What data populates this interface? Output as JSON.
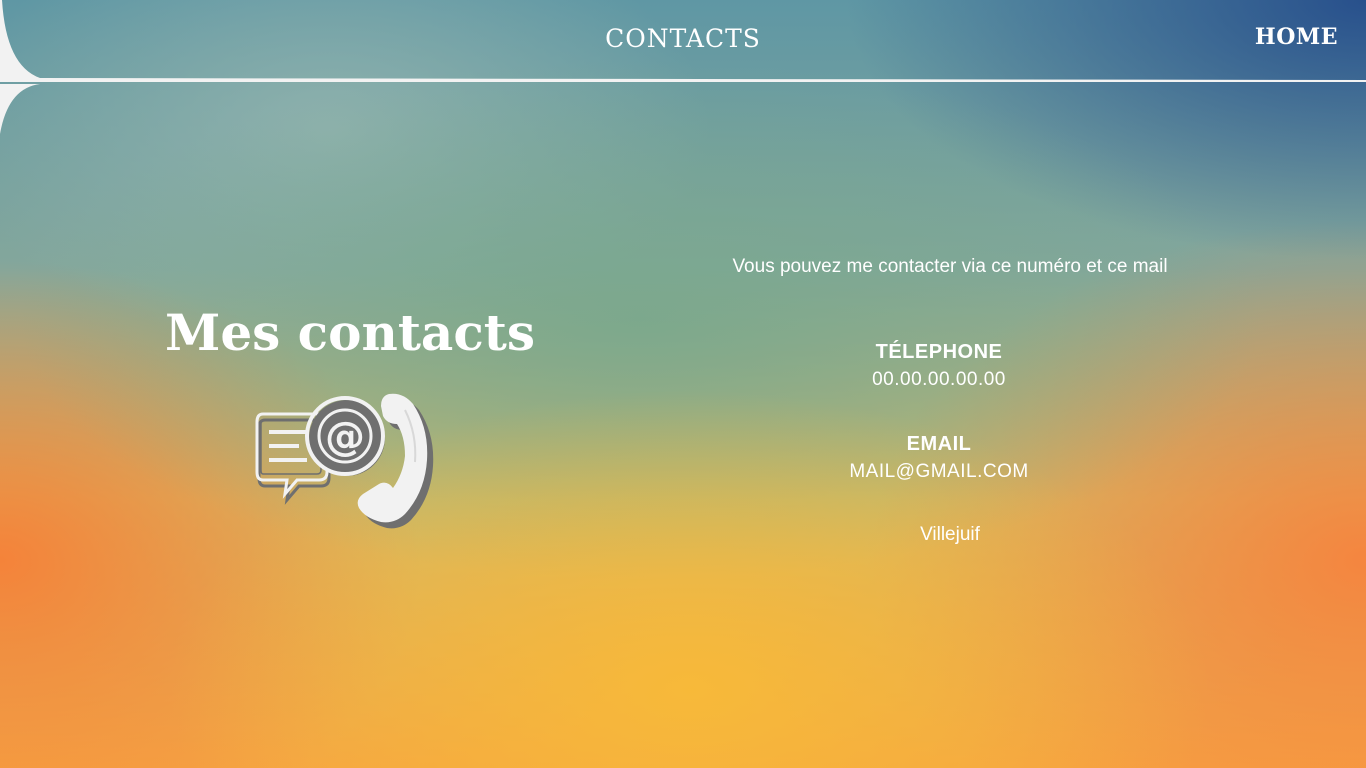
{
  "header": {
    "title": "CONTACTS",
    "home_label": "HOME"
  },
  "main": {
    "heading": "Mes contacts",
    "icon": "contact-email-phone-icon",
    "intro": "Vous pouvez me contacter via ce numéro et ce mail",
    "phone": {
      "label": "TÉLEPHONE",
      "value": "00.00.00.00.00"
    },
    "email": {
      "label": "EMAIL",
      "value": "MAIL@GMAIL.COM"
    },
    "city": "Villejuif"
  },
  "colors": {
    "text": "#ffffff",
    "frame": "#f2f2f2",
    "top_right": "#28508c",
    "bottom": "#f8ba38",
    "corners": "#f68038"
  }
}
